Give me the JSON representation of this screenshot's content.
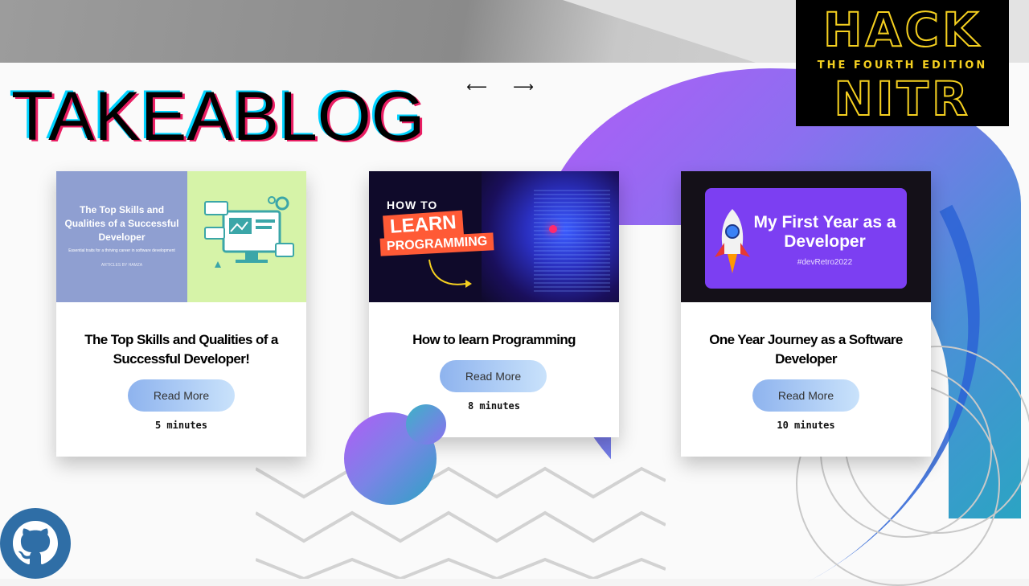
{
  "brand": {
    "title": "TAKEABLOG"
  },
  "nav": {
    "prev_label": "⟵",
    "next_label": "⟶"
  },
  "event_logo": {
    "line1": "HACK",
    "subtitle": "THE FOURTH EDITION",
    "line2": "NITR"
  },
  "cards": [
    {
      "thumb": {
        "heading": "The Top Skills and Qualities of a Successful Developer",
        "tagline": "Essential traits for a thriving career in software development",
        "byline": "ARTICLES BY HAMZA"
      },
      "title": "The Top Skills and Qualities of a Successful Developer!",
      "button": "Read More",
      "read_time": "5 minutes"
    },
    {
      "thumb": {
        "line1": "HOW TO",
        "line2": "LEARN",
        "line3": "PROGRAMMING"
      },
      "title": "How to learn Programming",
      "button": "Read More",
      "read_time": "8 minutes"
    },
    {
      "thumb": {
        "heading": "My First Year as a Developer",
        "tag": "#devRetro2022"
      },
      "title": "One Year Journey as a Software Developer",
      "button": "Read More",
      "read_time": "10 minutes"
    }
  ],
  "colors": {
    "accent_purple": "#8c6ff0",
    "accent_teal": "#2ba4c3",
    "button_gradient_start": "#8eb3ee",
    "button_gradient_end": "#c9e2fb",
    "hack_yellow": "#f5d020"
  },
  "icons": {
    "social": "github-icon"
  }
}
